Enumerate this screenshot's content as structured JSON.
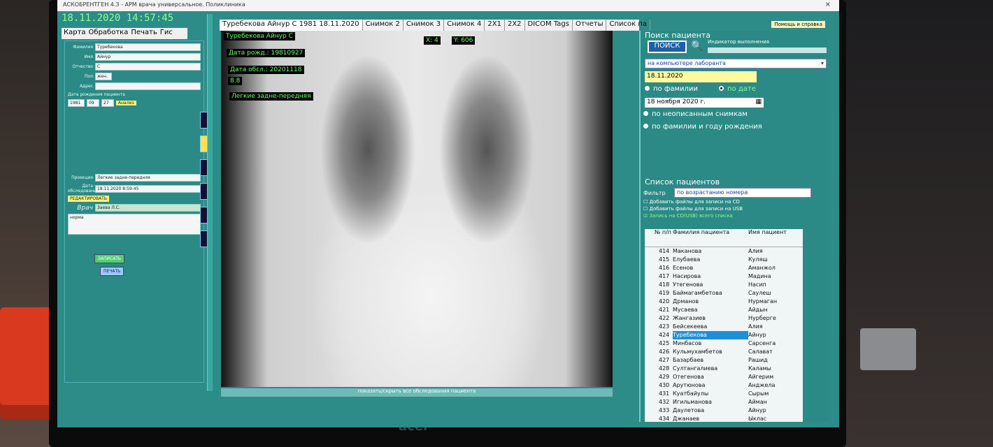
{
  "window": {
    "title": "АСКОБРЕНТГЕН 4.3 - АРМ врача универсальное. Поликлиника",
    "close": "×",
    "help": "Помощь и справка"
  },
  "clock": "18.11.2020 14:57:45",
  "menu": [
    "Карта",
    "Обработка",
    "Печать",
    "Гис"
  ],
  "card": {
    "fields": [
      {
        "label": "Фамилия",
        "value": "Туребекова"
      },
      {
        "label": "Имя",
        "value": "Айнур"
      },
      {
        "label": "Отчество",
        "value": "С"
      },
      {
        "label": "Пол",
        "value": "жен."
      },
      {
        "label": "Адрес",
        "value": ""
      }
    ],
    "birth_label": "Дата рождения пациента",
    "birth": [
      "1981",
      "09",
      "27"
    ],
    "analysis_btn": "Анализ",
    "exam_label": "Проекция",
    "exam_value": "Легкие задне-передняя",
    "date_label": "Дата обследования",
    "date_value": "18.11.2020 8:59:45",
    "doctor_label": "Врач",
    "doctor_value": "Заева Л.С.",
    "edit_btn": "РЕДАКТИРОВАТЬ",
    "save_btn": "ЗАПИСАТЬ",
    "print_btn": "ПЕЧАТЬ",
    "norm": "норма"
  },
  "tabs": [
    "Туребекова Айнур С 1981 18.11.2020",
    "Снимок 2",
    "Снимок 3",
    "Снимок 4",
    "2Х1",
    "2Х2",
    "DICOM Tags",
    "Отчеты",
    "Список па"
  ],
  "viewer": {
    "patient": "Туребекова Айнур С",
    "x": "X: 4",
    "y": "Y: 606",
    "birth": "Дата рожд.: 19810927",
    "exam_date": "Дата обсл.: 20201118",
    "val": "8.8",
    "projection": "Легкие задне-передняя",
    "footer": "показать/скрыть все обследования пациента"
  },
  "search": {
    "title": "Поиск пациента",
    "button": "ПОИСК",
    "indicator_label": "Индикатор выполнения",
    "location": "на компьютере лаборанта",
    "date": "18.11.2020",
    "by_surname": "по фамилии",
    "by_date": "по дате",
    "day": "18",
    "month": "ноября",
    "year": "2020 г.",
    "unread": "по неописанным снимкам",
    "surname_year": "по фамилии и году рождения"
  },
  "patients": {
    "title": "Список пациентов",
    "filter_label": "Фильтр",
    "filter_value": "по возрастанию номера",
    "add_cd": "Добавить файлы для записи на CD",
    "add_usb": "Добавить файлы для записи на USB",
    "write_all": "Запись на CD(USB) всего списка",
    "headers": [
      "№ п/п",
      "Фамилия пациента",
      "Имя пациент"
    ],
    "rows": [
      [
        "414",
        "Маканова",
        "Алия"
      ],
      [
        "415",
        "Елубаева",
        "Куляш"
      ],
      [
        "416",
        "Есенов",
        "Аманжол"
      ],
      [
        "417",
        "Насирова",
        "Мадина"
      ],
      [
        "418",
        "Утегенова",
        "Насип"
      ],
      [
        "419",
        "Баймагамбетова",
        "Саулеш"
      ],
      [
        "420",
        "Дрманов",
        "Нурмаган"
      ],
      [
        "421",
        "Мусаева",
        "Айдын"
      ],
      [
        "422",
        "Жангазиев",
        "Нурберге"
      ],
      [
        "423",
        "Бейсекеева",
        "Алия"
      ],
      [
        "424",
        "Туребекова",
        "Айнур"
      ],
      [
        "425",
        "Минбасов",
        "Сарсенга"
      ],
      [
        "426",
        "Кульмухамбетов",
        "Салават"
      ],
      [
        "427",
        "Базарбаев",
        "Рашид"
      ],
      [
        "428",
        "Султангалиева",
        "Каламы"
      ],
      [
        "429",
        "Отегенова",
        "Айгерим"
      ],
      [
        "430",
        "Арутюнова",
        "Анджела"
      ],
      [
        "431",
        "Куатбайулы",
        "Сырым"
      ],
      [
        "432",
        "Игильманова",
        "Айман"
      ],
      [
        "433",
        "Даулетова",
        "Айнур"
      ],
      [
        "434",
        "Джанаев",
        "Ыклас"
      ]
    ],
    "selected_index": 10
  },
  "monitor_brand": "acer"
}
